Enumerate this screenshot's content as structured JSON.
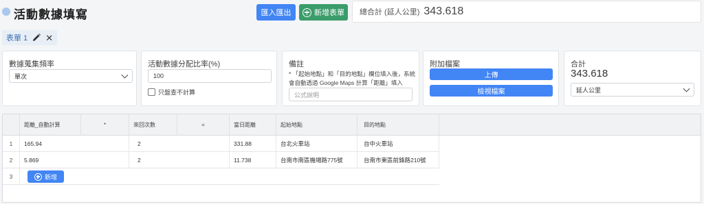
{
  "header": {
    "title": "活動數據填寫",
    "import_export_label": "匯入匯出",
    "new_sheet_label": "新增表單",
    "total_label": "總合計 (延人公里)",
    "total_value": "343.618"
  },
  "tab": {
    "label": "表單 1"
  },
  "cards": {
    "frequency": {
      "label": "數據蒐集頻率",
      "value": "單次"
    },
    "ratio": {
      "label": "活動數據分配比率(%)",
      "value": "100",
      "checkbox_label": "只盤查不計算"
    },
    "remarks": {
      "label": "備註",
      "note": "* 「起始地點」和「目的地點」欄位填入後，系統會自動透過 Google Maps 計算「距離」填入",
      "placeholder": "公式說明"
    },
    "attachments": {
      "label": "附加檔案",
      "upload_label": "上傳",
      "view_label": "檢視檔案"
    },
    "sum": {
      "label": "合計",
      "value": "343.618",
      "unit": "延人公里"
    }
  },
  "table": {
    "headers": [
      "距離_自動計算",
      "*",
      "來回次數",
      "=",
      "當日距離",
      "起始地點",
      "目的地點"
    ],
    "rows": [
      {
        "num": "1",
        "distance": "165.94",
        "trips": "2",
        "daily": "331.88",
        "origin": "台北火車站",
        "destination": "台中火車站"
      },
      {
        "num": "2",
        "distance": "5.869",
        "trips": "2",
        "daily": "11.738",
        "origin": "台南市南區機場路775號",
        "destination": "台南市東區前鋒路210號"
      }
    ],
    "add_row_num": "3",
    "add_label": "新增"
  },
  "colors": {
    "primary": "#4285f4",
    "success": "#3a9c6a",
    "title_dot": "#a9c8ec"
  }
}
